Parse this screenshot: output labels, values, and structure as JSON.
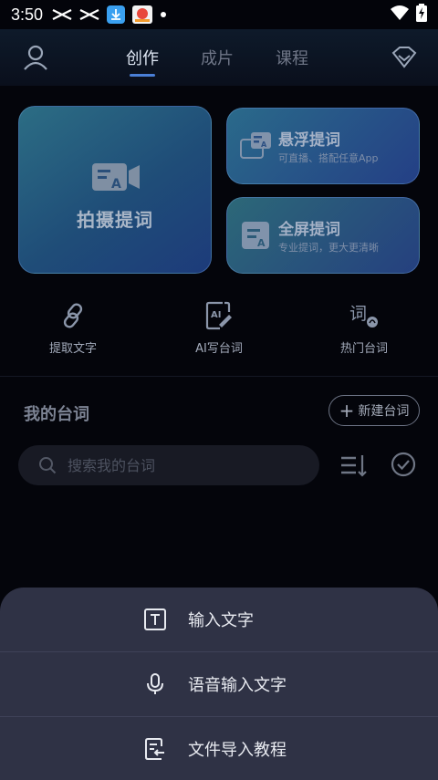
{
  "status_bar": {
    "time": "3:50",
    "icons": [
      "x-cross-icon",
      "x-cross-icon",
      "download-icon",
      "app-notification-icon",
      "dot-icon",
      "wifi-icon",
      "battery-charging-icon"
    ]
  },
  "header": {
    "tabs": [
      {
        "label": "创作",
        "active": true
      },
      {
        "label": "成片",
        "active": false
      },
      {
        "label": "课程",
        "active": false
      }
    ],
    "user_icon": "user-icon",
    "vip_icon": "diamond-icon"
  },
  "cards": {
    "shoot": {
      "title": "拍摄提词",
      "icon": "teleprompter-camera-icon"
    },
    "float": {
      "title": "悬浮提词",
      "subtitle": "可直播、搭配任意App",
      "icon": "float-window-icon"
    },
    "fullscreen": {
      "title": "全屏提词",
      "subtitle": "专业提词，更大更清晰",
      "icon": "fullscreen-text-icon"
    }
  },
  "tools": [
    {
      "label": "提取文字",
      "icon": "link-icon"
    },
    {
      "label": "AI写台词",
      "icon": "ai-write-icon"
    },
    {
      "label": "热门台词",
      "icon": "hot-script-icon"
    }
  ],
  "scripts": {
    "title": "我的台词",
    "new_button": "新建台词",
    "search_placeholder": "搜索我的台词"
  },
  "sheet": {
    "items": [
      {
        "label": "输入文字",
        "icon": "text-input-icon"
      },
      {
        "label": "语音输入文字",
        "icon": "microphone-icon"
      },
      {
        "label": "文件导入教程",
        "icon": "file-import-icon"
      }
    ]
  },
  "colors": {
    "background": "#04050b",
    "card_gradient_start": "#2c6d84",
    "card_gradient_end": "#1d3b7a",
    "tab_active": "#dfe7f3",
    "tab_underline": "#4a7fd6",
    "sheet_background": "#2f3245"
  }
}
